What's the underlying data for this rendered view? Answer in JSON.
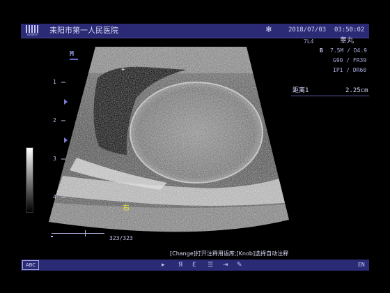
{
  "header": {
    "logo_text": "WINDRAY",
    "hospital": "耒阳市第一人民医院",
    "freeze_icon": "❄",
    "date": "2018/07/03",
    "time": "03:50:02"
  },
  "right_panel": {
    "probe": "7L4",
    "organ": "睾丸",
    "mode": "B",
    "freq_depth": "7.5M / D4.9",
    "gain_frame": "G90 / FR39",
    "power_range": "IP1 / DR60"
  },
  "measurement": {
    "label": "距离1",
    "value": "2.25cm"
  },
  "left_panel": {
    "mode_marker": "M",
    "depth_marks": [
      "1",
      "2",
      "3",
      "4"
    ]
  },
  "image": {
    "side_label": "右",
    "cursor_glyph": "+"
  },
  "cine": {
    "count": "323/323"
  },
  "hint": "[Change]打开注释用语库;[Knob]选择自动注释",
  "status_bar": {
    "abc": "ABC",
    "icons": [
      "pointer-icon",
      "rotate-r-icon",
      "rotate-l-icon",
      "list-icon",
      "arrow-right-icon",
      "pen-icon"
    ],
    "language": "EN"
  }
}
